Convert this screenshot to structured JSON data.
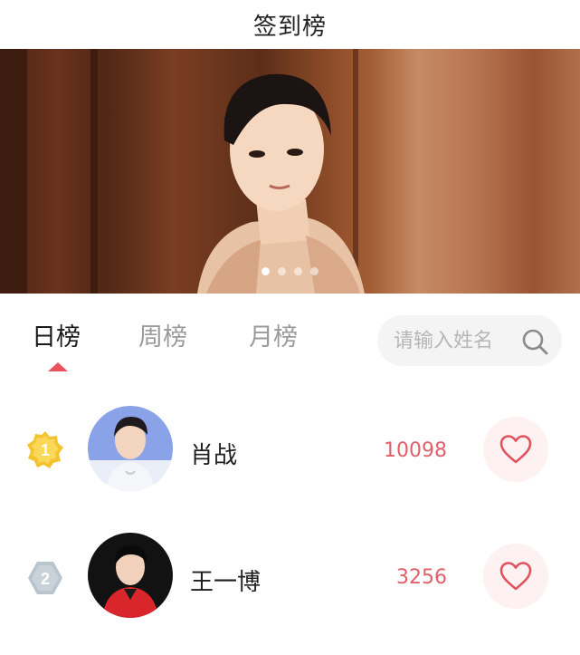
{
  "header": {
    "title": "签到榜"
  },
  "banner": {
    "slides": 4,
    "active_slide": 1
  },
  "tabs": [
    {
      "label": "日榜",
      "active": true
    },
    {
      "label": "周榜",
      "active": false
    },
    {
      "label": "月榜",
      "active": false
    }
  ],
  "search": {
    "placeholder": "请输入姓名",
    "value": ""
  },
  "ranking": [
    {
      "rank": "1",
      "name": "肖战",
      "score": "10098"
    },
    {
      "rank": "2",
      "name": "王一博",
      "score": "3256"
    }
  ],
  "colors": {
    "accent": "#e8535e",
    "gold": "#f4c430",
    "silver": "#b9c4cc"
  },
  "icons": {
    "search": "search-icon",
    "like": "heart-icon"
  }
}
